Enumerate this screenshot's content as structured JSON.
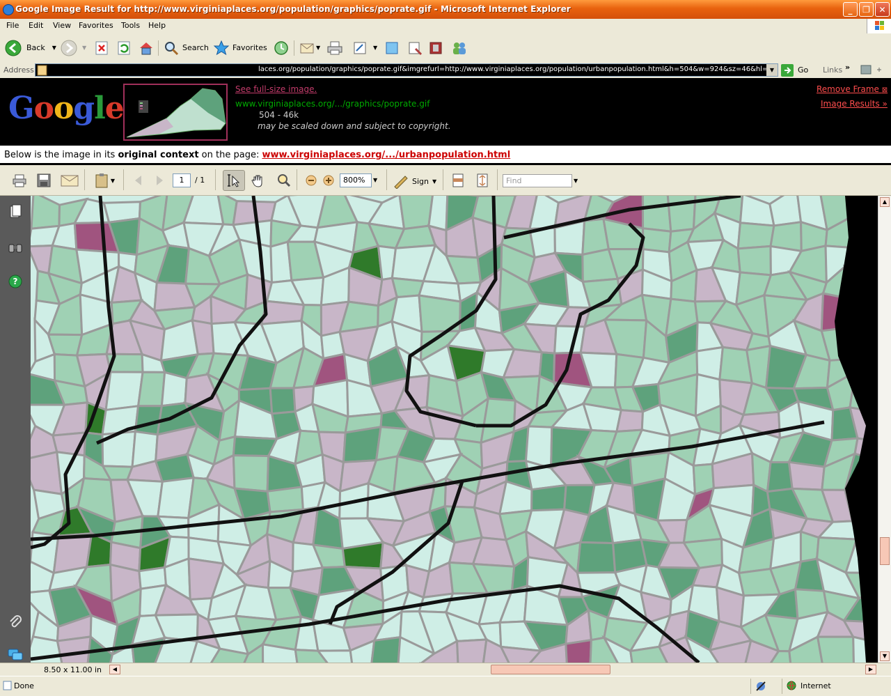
{
  "window": {
    "title": "Google Image Result for http://www.virginiaplaces.org/population/graphics/poprate.gif - Microsoft Internet Explorer",
    "minimize_label": "_",
    "maximize_label": "❐",
    "close_label": "✕"
  },
  "menu": [
    "File",
    "Edit",
    "View",
    "Favorites",
    "Tools",
    "Help"
  ],
  "toolbar": {
    "back_label": "Back",
    "search_label": "Search",
    "favorites_label": "Favorites"
  },
  "address": {
    "label": "Address",
    "value": "laces.org/population/graphics/poprate.gif&imgrefurl=http://www.virginiaplaces.org/population/urbanpopulation.html&h=504&w=924&sz=46&hl=en&st",
    "go_label": "Go",
    "links_label": "Links"
  },
  "google_frame": {
    "logo_text": "Google",
    "see_full_size": "See full-size image.",
    "image_url": "www.virginiaplaces.org/.../graphics/poprate.gif",
    "image_size": "504 - 46k",
    "copyright_note": "may be scaled down and subject to copyright.",
    "remove_frame": "Remove Frame",
    "image_results": "Image Results »",
    "colors": {
      "link": "#c43c6b",
      "url": "#00aa00",
      "red": "#ff4d4d"
    }
  },
  "context": {
    "prefix": "Below is the image in its ",
    "emphasis": "original context",
    "middle": " on the page: ",
    "link": "www.virginiaplaces.org/.../urbanpopulation.html"
  },
  "pdf_toolbar": {
    "page_current": "1",
    "page_total": "/ 1",
    "zoom": "800%",
    "sign_label": "Sign",
    "find_placeholder": "Find"
  },
  "pdf_status": {
    "page_size": "8.50 x 11.00 in"
  },
  "status": {
    "left": "Done",
    "zone": "Internet"
  },
  "map_colors": {
    "light": "#cfeee6",
    "lavender": "#c8b6c8",
    "green_light": "#9fd1b4",
    "green_mid": "#5ea27c",
    "green_dark": "#2f7a2a",
    "magenta": "#a0547f",
    "border": "#9a9a9a",
    "state_line": "#111111"
  }
}
